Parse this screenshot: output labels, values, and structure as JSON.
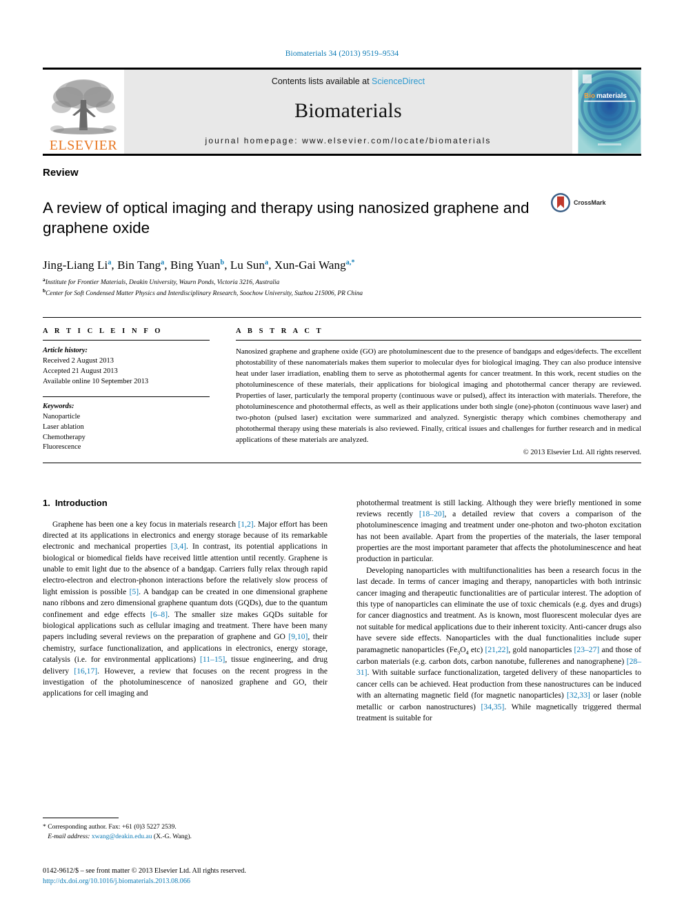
{
  "running_head": "Biomaterials 34 (2013) 9519–9534",
  "masthead": {
    "publisher_name": "ELSEVIER",
    "contents_prefix": "Contents lists available at ",
    "contents_link": "ScienceDirect",
    "journal_name": "Biomaterials",
    "homepage": "journal homepage: www.elsevier.com/locate/biomaterials",
    "cover_title_a": "Bio",
    "cover_title_b": "materials"
  },
  "article": {
    "doctype": "Review",
    "title": "A review of optical imaging and therapy using nanosized graphene and graphene oxide",
    "crossmark_label": "CrossMark",
    "authors": "Jing-Liang Li a, Bin Tang a, Bing Yuan b, Lu Sun a, Xun-Gai Wang a,*",
    "affiliation_a": "Institute for Frontier Materials, Deakin University, Waurn Ponds, Victoria 3216, Australia",
    "affiliation_b": "Center for Soft Condensed Matter Physics and Interdisciplinary Research, Soochow University, Suzhou 215006, PR China"
  },
  "article_info": {
    "heading": "A R T I C L E    I N F O",
    "history_label": "Article history:",
    "history": [
      "Received 2 August 2013",
      "Accepted 21 August 2013",
      "Available online 10 September 2013"
    ],
    "keywords_label": "Keywords:",
    "keywords": [
      "Nanoparticle",
      "Laser ablation",
      "Chemotherapy",
      "Fluorescence"
    ]
  },
  "abstract": {
    "heading": "A B S T R A C T",
    "text": "Nanosized graphene and graphene oxide (GO) are photoluminescent due to the presence of bandgaps and edges/defects. The excellent photostability of these nanomaterials makes them superior to molecular dyes for biological imaging. They can also produce intensive heat under laser irradiation, enabling them to serve as photothermal agents for cancer treatment. In this work, recent studies on the photoluminescence of these materials, their applications for biological imaging and photothermal cancer therapy are reviewed. Properties of laser, particularly the temporal property (continuous wave or pulsed), affect its interaction with materials. Therefore, the photoluminescence and photothermal effects, as well as their applications under both single (one)-photon (continuous wave laser) and two-photon (pulsed laser) excitation were summarized and analyzed. Synergistic therapy which combines chemotherapy and photothermal therapy using these materials is also reviewed. Finally, critical issues and challenges for further research and in medical applications of these materials are analyzed.",
    "copyright": "© 2013 Elsevier Ltd. All rights reserved."
  },
  "introduction": {
    "section_number": "1.",
    "section_title": "Introduction",
    "left_paragraph_1_parts": [
      "Graphene has been one a key focus in materials research ",
      "[1,2]",
      ". Major effort has been directed at its applications in electronics and energy storage because of its remarkable electronic and mechanical properties ",
      "[3,4]",
      ". In contrast, its potential applications in biological or biomedical fields have received little attention until recently. Graphene is unable to emit light due to the absence of a bandgap. Carriers fully relax through rapid electro-electron and electron-phonon interactions before the relatively slow process of light emission is possible ",
      "[5]",
      ". A bandgap can be created in one dimensional graphene nano ribbons and zero dimensional graphene quantum dots (GQDs), due to the quantum confinement and edge effects ",
      "[6–8]",
      ". The smaller size makes GQDs suitable for biological applications such as cellular imaging and treatment. There have been many papers including several reviews on the preparation of graphene and GO ",
      "[9,10]",
      ", their chemistry, surface functionalization, and applications in electronics, energy storage, catalysis (i.e. for environmental applications) ",
      "[11–15]",
      ", tissue engineering, and drug delivery ",
      "[16,17]",
      ". However, a review that focuses on the recent progress in the investigation of the photoluminescence of nanosized graphene and GO, their applications for cell imaging and"
    ],
    "right_paragraph_1_parts": [
      "photothermal treatment is still lacking. Although they were briefly mentioned in some reviews recently ",
      "[18–20]",
      ", a detailed review that covers a comparison of the photoluminescence imaging and treatment under one-photon and two-photon excitation has not been available. Apart from the properties of the materials, the laser temporal properties are the most important parameter that affects the photoluminescence and heat production in particular."
    ],
    "right_paragraph_2_parts": [
      "Developing nanoparticles with multifunctionalities has been a research focus in the last decade. In terms of cancer imaging and therapy, nanoparticles with both intrinsic cancer imaging and therapeutic functionalities are of particular interest. The adoption of this type of nanoparticles can eliminate the use of toxic chemicals (e.g. dyes and drugs) for cancer diagnostics and treatment. As is known, most fluorescent molecular dyes are not suitable for medical applications due to their inherent toxicity. Anti-cancer drugs also have severe side effects. Nanoparticles with the dual functionalities include super paramagnetic nanoparticles (Fe",
      "3",
      "O",
      "4",
      " etc) ",
      "[21,22]",
      ", gold nanoparticles ",
      "[23–27]",
      " and those of carbon materials (e.g. carbon dots, carbon nanotube, fullerenes and nanographene) ",
      "[28–31]",
      ". With suitable surface functionalization, targeted delivery of these nanoparticles to cancer cells can be achieved. Heat production from these nanostructures can be induced with an alternating magnetic field (for magnetic nanoparticles) ",
      "[32,33]",
      " or laser (noble metallic or carbon nanostructures) ",
      "[34,35]",
      ". While magnetically triggered thermal treatment is suitable for"
    ]
  },
  "footnote": {
    "corresponding": "* Corresponding author. Fax: +61 (0)3 5227 2539.",
    "email_label": "E-mail address:",
    "email": "xwang@deakin.edu.au",
    "email_suffix": "(X.-G. Wang)."
  },
  "footer": {
    "issn_line": "0142-9612/$ – see front matter © 2013 Elsevier Ltd. All rights reserved.",
    "doi": "http://dx.doi.org/10.1016/j.biomaterials.2013.08.066"
  },
  "colors": {
    "link_blue": "#0b7ab5",
    "sciencedirect_blue": "#2e9ad0",
    "elsevier_orange": "#E87722",
    "band_gray": "#e8e8e8"
  }
}
